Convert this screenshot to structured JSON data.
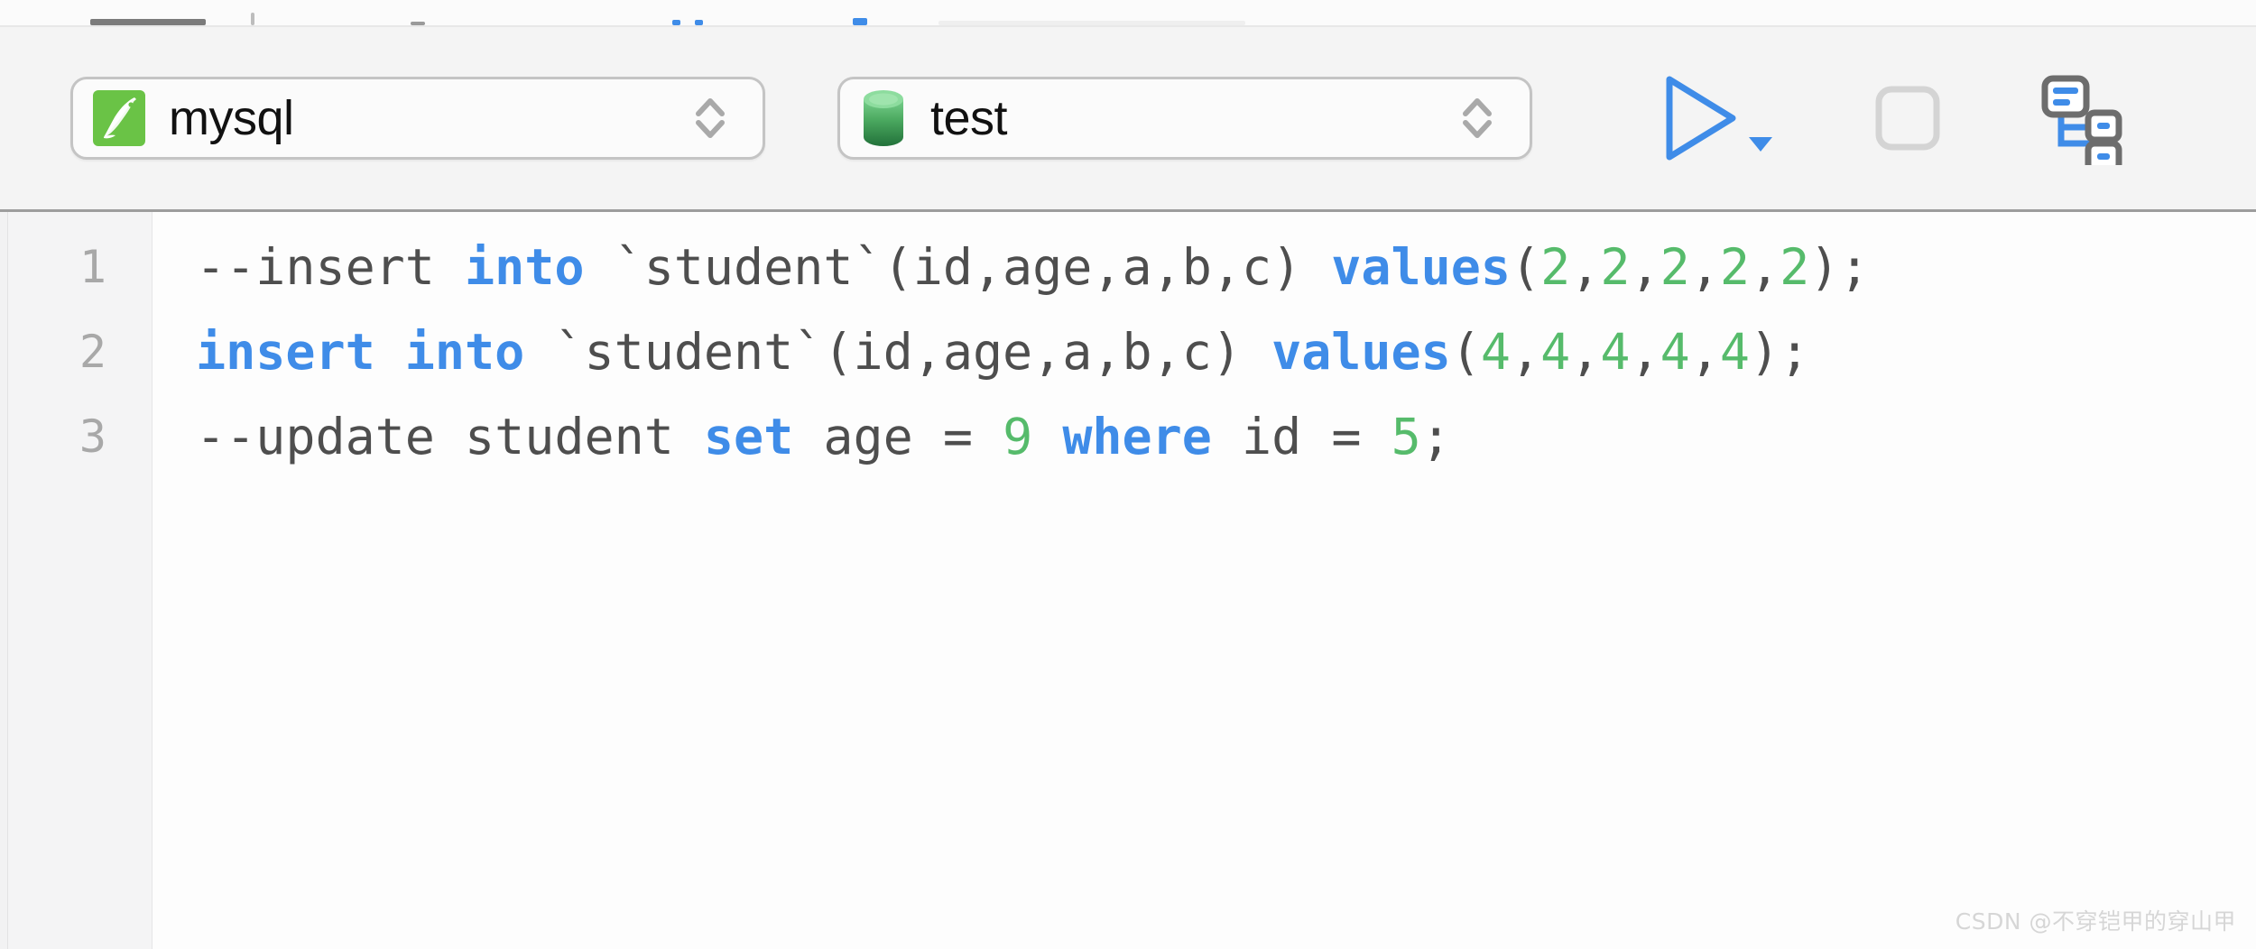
{
  "toolbar": {
    "driver_select": {
      "value": "mysql",
      "icon": "mysql-dolphin-icon",
      "stepper_icon": "chevron-up-down-icon"
    },
    "schema_select": {
      "value": "test",
      "icon": "database-cylinder-icon",
      "stepper_icon": "chevron-up-down-icon"
    },
    "actions": [
      {
        "name": "run-button",
        "icon": "play-triangle-icon",
        "label": "Run",
        "color": "#3f8ce8",
        "enabled": true
      },
      {
        "name": "run-options-button",
        "icon": "caret-down-icon",
        "label": "Run options",
        "color": "#3f8ce8",
        "enabled": true
      },
      {
        "name": "stop-button",
        "icon": "stop-square-icon",
        "label": "Stop",
        "color": "#d0d0d0",
        "enabled": false
      },
      {
        "name": "schema-diagram-button",
        "icon": "schema-diagram-icon",
        "label": "Schema diagram",
        "color": "#3f8ce8",
        "enabled": true
      }
    ]
  },
  "editor": {
    "lines": [
      {
        "number": "1",
        "tokens": [
          {
            "text": "--insert ",
            "type": "comment"
          },
          {
            "text": "into",
            "type": "keyword"
          },
          {
            "text": " `student`(id,age,a,b,c) ",
            "type": "plain"
          },
          {
            "text": "values",
            "type": "keyword"
          },
          {
            "text": "(",
            "type": "plain"
          },
          {
            "text": "2",
            "type": "number"
          },
          {
            "text": ",",
            "type": "plain"
          },
          {
            "text": "2",
            "type": "number"
          },
          {
            "text": ",",
            "type": "plain"
          },
          {
            "text": "2",
            "type": "number"
          },
          {
            "text": ",",
            "type": "plain"
          },
          {
            "text": "2",
            "type": "number"
          },
          {
            "text": ",",
            "type": "plain"
          },
          {
            "text": "2",
            "type": "number"
          },
          {
            "text": ");",
            "type": "plain"
          }
        ]
      },
      {
        "number": "2",
        "tokens": [
          {
            "text": "insert into",
            "type": "keyword"
          },
          {
            "text": " `student`(id,age,a,b,c) ",
            "type": "plain"
          },
          {
            "text": "values",
            "type": "keyword"
          },
          {
            "text": "(",
            "type": "plain"
          },
          {
            "text": "4",
            "type": "number"
          },
          {
            "text": ",",
            "type": "plain"
          },
          {
            "text": "4",
            "type": "number"
          },
          {
            "text": ",",
            "type": "plain"
          },
          {
            "text": "4",
            "type": "number"
          },
          {
            "text": ",",
            "type": "plain"
          },
          {
            "text": "4",
            "type": "number"
          },
          {
            "text": ",",
            "type": "plain"
          },
          {
            "text": "4",
            "type": "number"
          },
          {
            "text": ");",
            "type": "plain"
          }
        ]
      },
      {
        "number": "3",
        "tokens": [
          {
            "text": "--update student ",
            "type": "comment"
          },
          {
            "text": "set",
            "type": "keyword"
          },
          {
            "text": " age = ",
            "type": "plain"
          },
          {
            "text": "9",
            "type": "number"
          },
          {
            "text": " ",
            "type": "plain"
          },
          {
            "text": "where",
            "type": "keyword"
          },
          {
            "text": " id = ",
            "type": "plain"
          },
          {
            "text": "5",
            "type": "number"
          },
          {
            "text": ";",
            "type": "plain"
          }
        ]
      }
    ]
  },
  "watermark": {
    "text": "CSDN @不穿铠甲的穿山甲"
  },
  "colors": {
    "keyword": "#3f8ce8",
    "number": "#56bb6b",
    "text": "#4e4e4e",
    "gutter_number": "#a8a8a8",
    "toolbar_bg": "#f4f4f4",
    "editor_bg": "#fdfdfd",
    "mysql_green": "#6ac346",
    "db_green": "#3f9e52"
  }
}
